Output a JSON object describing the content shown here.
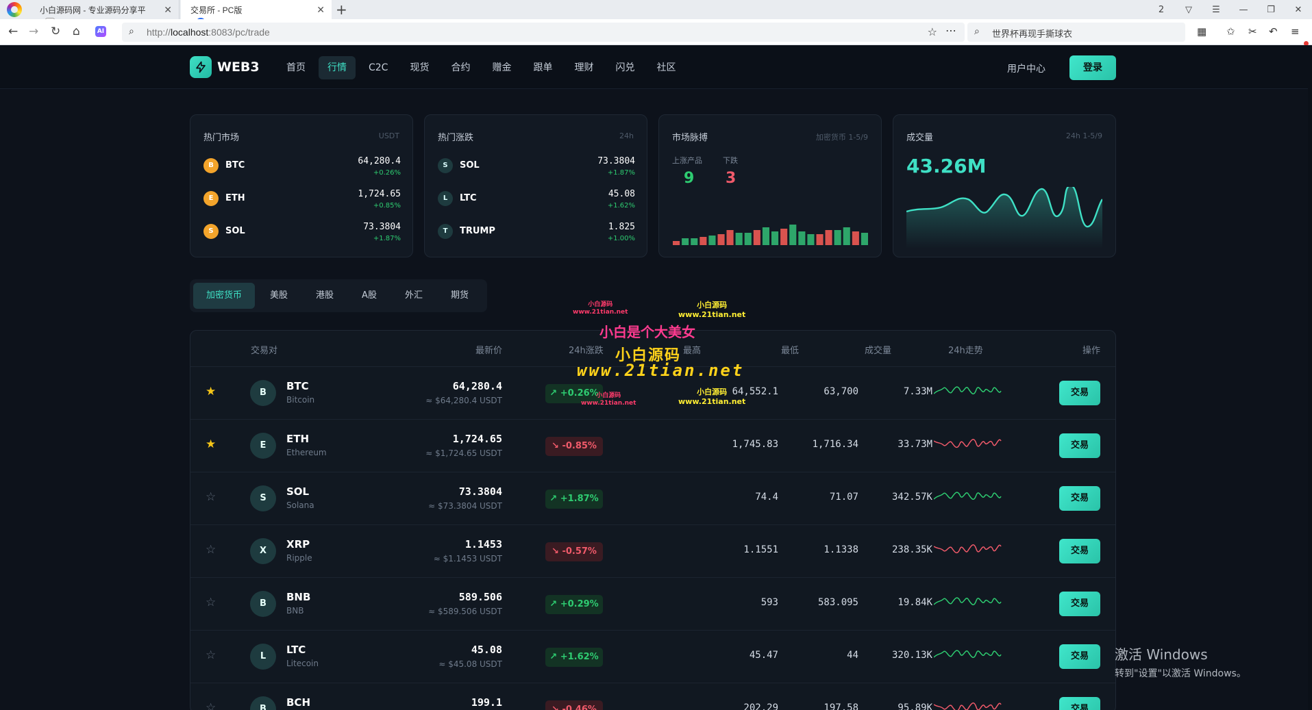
{
  "browser": {
    "tabs": [
      {
        "title": "小白源码网 - 专业源码分享平",
        "active": false
      },
      {
        "title": "交易所 - PC版",
        "active": true
      }
    ],
    "address": {
      "prefix": "http://",
      "host": "localhost",
      "rest": ":8083/pc/trade"
    },
    "search_text": "世界杯再现手撕球衣",
    "tab_count_badge": "2"
  },
  "header": {
    "brand": "WEB3",
    "nav": [
      "首页",
      "行情",
      "C2C",
      "现货",
      "合约",
      "赠金",
      "跟单",
      "理财",
      "闪兑",
      "社区"
    ],
    "active_nav": "行情",
    "user_center": "用户中心",
    "login": "登录"
  },
  "cards": {
    "hot_market": {
      "title": "热门市场",
      "sub": "USDT",
      "items": [
        {
          "icon": "B",
          "symbol": "BTC",
          "price": "64,280.4",
          "change": "+0.26%"
        },
        {
          "icon": "E",
          "symbol": "ETH",
          "price": "1,724.65",
          "change": "+0.85%"
        },
        {
          "icon": "S",
          "symbol": "SOL",
          "price": "73.3804",
          "change": "+1.87%"
        }
      ]
    },
    "hot_gainers": {
      "title": "热门涨跌",
      "sub": "24h",
      "items": [
        {
          "icon": "S",
          "symbol": "SOL",
          "price": "73.3804",
          "change": "+1.87%"
        },
        {
          "icon": "L",
          "symbol": "LTC",
          "price": "45.08",
          "change": "+1.62%"
        },
        {
          "icon": "T",
          "symbol": "TRUMP",
          "price": "1.825",
          "change": "+1.00%"
        }
      ]
    },
    "pulse": {
      "title": "市场脉搏",
      "sub": "加密货币 1-5/9",
      "up_label": "上涨产品",
      "up_value": "9",
      "down_label": "下跌",
      "down_value": "3",
      "colors": {
        "up": "#2ecc71",
        "down": "#f05a6a"
      }
    },
    "volume": {
      "title": "成交量",
      "sub": "24h 1-5/9",
      "value": "43.26M",
      "accent": "#3fe0c5"
    }
  },
  "categories": [
    "加密货币",
    "美股",
    "港股",
    "A股",
    "外汇",
    "期货"
  ],
  "active_category": "加密货币",
  "table": {
    "headers": {
      "pair": "交易对",
      "price": "最新价",
      "change": "24h涨跌",
      "high": "最高",
      "low": "最低",
      "volume": "成交量",
      "trend": "24h走势",
      "action": "操作"
    },
    "trade_label": "交易",
    "rows": [
      {
        "fav": true,
        "icon": "B",
        "symbol": "BTC",
        "name": "Bitcoin",
        "price": "64,280.4",
        "price_usd": "≈ $64,280.4 USDT",
        "change": "+0.26%",
        "dir": "up",
        "high": "64,552.1",
        "low": "63,700",
        "volume": "7.33M"
      },
      {
        "fav": true,
        "icon": "E",
        "symbol": "ETH",
        "name": "Ethereum",
        "price": "1,724.65",
        "price_usd": "≈ $1,724.65 USDT",
        "change": "-0.85%",
        "dir": "down",
        "high": "1,745.83",
        "low": "1,716.34",
        "volume": "33.73M"
      },
      {
        "fav": false,
        "icon": "S",
        "symbol": "SOL",
        "name": "Solana",
        "price": "73.3804",
        "price_usd": "≈ $73.3804 USDT",
        "change": "+1.87%",
        "dir": "up",
        "high": "74.4",
        "low": "71.07",
        "volume": "342.57K"
      },
      {
        "fav": false,
        "icon": "X",
        "symbol": "XRP",
        "name": "Ripple",
        "price": "1.1453",
        "price_usd": "≈ $1.1453 USDT",
        "change": "-0.57%",
        "dir": "down",
        "high": "1.1551",
        "low": "1.1338",
        "volume": "238.35K"
      },
      {
        "fav": false,
        "icon": "B",
        "symbol": "BNB",
        "name": "BNB",
        "price": "589.506",
        "price_usd": "≈ $589.506 USDT",
        "change": "+0.29%",
        "dir": "up",
        "high": "593",
        "low": "583.095",
        "volume": "19.84K"
      },
      {
        "fav": false,
        "icon": "L",
        "symbol": "LTC",
        "name": "Litecoin",
        "price": "45.08",
        "price_usd": "≈ $45.08 USDT",
        "change": "+1.62%",
        "dir": "up",
        "high": "45.47",
        "low": "44",
        "volume": "320.13K"
      },
      {
        "fav": false,
        "icon": "B",
        "symbol": "BCH",
        "name": "",
        "price": "199.1",
        "price_usd": "",
        "change": "-0.46%",
        "dir": "down",
        "high": "202.29",
        "low": "197.58",
        "volume": "95.89K"
      }
    ]
  },
  "watermarks": {
    "small_red": "小白源码",
    "small_red_url": "www.21tian.net",
    "small_yellow": "小白源码",
    "small_yellow_url": "www.21tian.net",
    "main": "小白是个大美女",
    "big1": "小白源码",
    "big2": "www.21tian.net"
  },
  "os": {
    "activation_title": "激活 Windows",
    "activation_sub": "转到\"设置\"以激活 Windows。"
  }
}
